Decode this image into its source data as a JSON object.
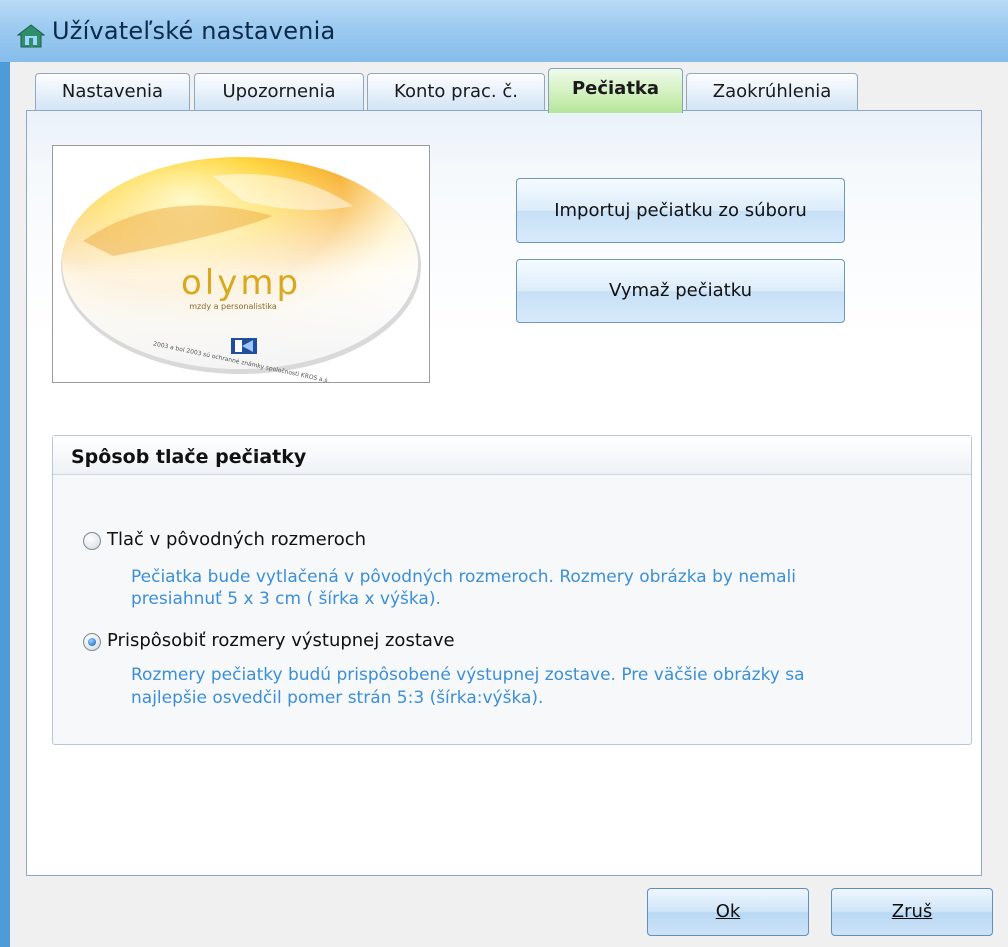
{
  "window": {
    "title": "Užívateľské nastavenia",
    "title_icon": "house-icon"
  },
  "tabs": [
    {
      "label": "Nastavenia",
      "active": false
    },
    {
      "label": "Upozornenia",
      "active": false
    },
    {
      "label": "Konto prac. č.",
      "active": false
    },
    {
      "label": "Pečiatka",
      "active": true
    },
    {
      "label": "Zaokrúhlenia",
      "active": false
    }
  ],
  "stamp": {
    "brand": "olymp",
    "tagline": "mzdy a personalistika",
    "rim_text": "2003 a bol 2003 sú ochranné známky spoločnosti KROS a.s.",
    "logo": "kros-logo"
  },
  "actions": {
    "import_label": "Importuj pečiatku zo súboru",
    "delete_label": "Vymaž pečiatku"
  },
  "print_group": {
    "title": "Spôsob tlače pečiatky",
    "options": [
      {
        "label": "Tlač v pôvodných rozmeroch",
        "desc_line1": "Pečiatka bude vytlačená v pôvodných rozmeroch. Rozmery obrázka by nemali",
        "desc_line2": "presiahnuť 5 x 3 cm ( šírka x výška).",
        "checked": false
      },
      {
        "label": "Prispôsobiť rozmery výstupnej zostave",
        "desc_line1": "Rozmery pečiatky budú prispôsobené výstupnej zostave. Pre väčšie obrázky sa",
        "desc_line2": "najlepšie osvedčil  pomer strán 5:3 (šírka:výška).",
        "checked": true
      }
    ]
  },
  "footer": {
    "ok_label": "Ok",
    "cancel_label": "Zruš"
  },
  "colors": {
    "title_bar": "#9ccaf0",
    "active_tab": "#c8ecb0",
    "description_text": "#3b8fd6"
  }
}
